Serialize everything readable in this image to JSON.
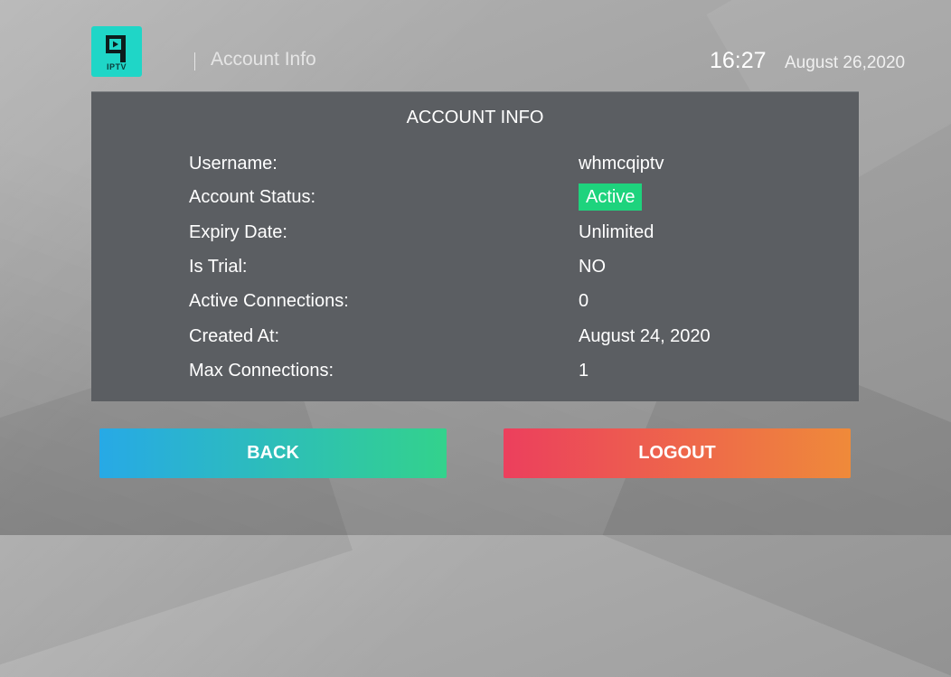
{
  "header": {
    "logo_text": "IPTV",
    "screen_title": "Account Info",
    "time": "16:27",
    "date": "August 26,2020"
  },
  "panel": {
    "title": "ACCOUNT INFO",
    "rows": [
      {
        "label": "Username:",
        "value": "whmcqiptv"
      },
      {
        "label": "Account Status:",
        "value": "Active"
      },
      {
        "label": "Expiry Date:",
        "value": "Unlimited"
      },
      {
        "label": "Is Trial:",
        "value": "NO"
      },
      {
        "label": "Active Connections:",
        "value": "0"
      },
      {
        "label": "Created At:",
        "value": "August 24, 2020"
      },
      {
        "label": "Max Connections:",
        "value": "1"
      }
    ]
  },
  "buttons": {
    "back_label": "BACK",
    "logout_label": "LOGOUT"
  },
  "colors": {
    "logo": "#1fd6c7",
    "panel": "#5b5e62",
    "status_active": "#1ed37d",
    "back_gradient": [
      "#27a9e6",
      "#33d28c"
    ],
    "logout_gradient": [
      "#ec3f5d",
      "#ef8a3a"
    ]
  }
}
